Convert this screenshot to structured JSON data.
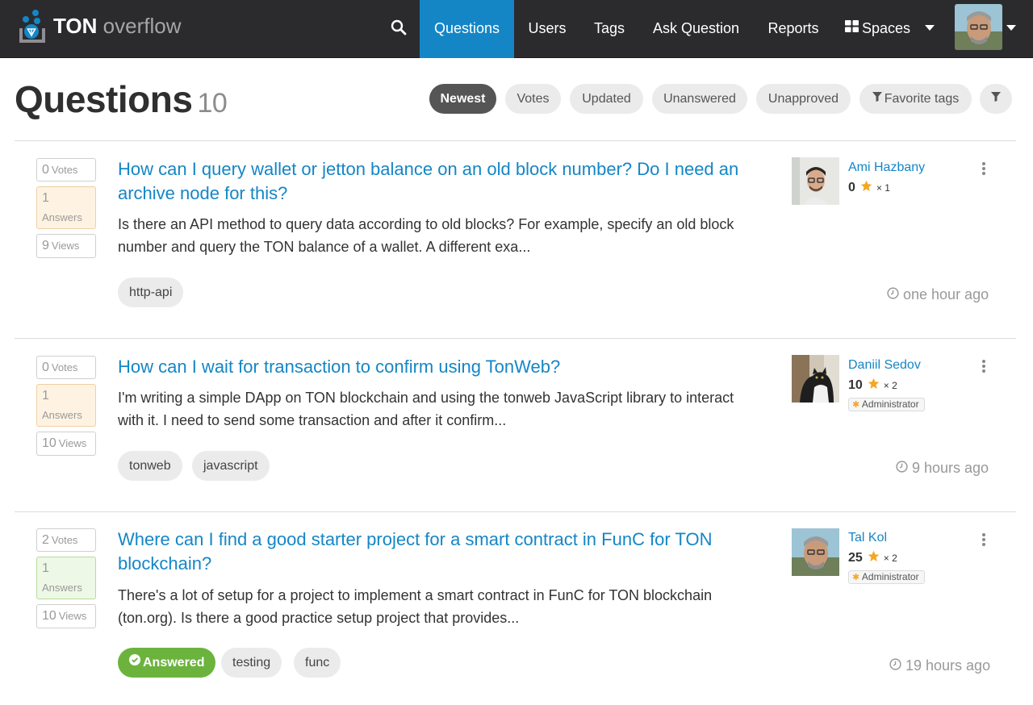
{
  "app": {
    "brand_bold": "TON",
    "brand_light": "overflow"
  },
  "nav": {
    "items": [
      {
        "label": "Questions",
        "active": true
      },
      {
        "label": "Users"
      },
      {
        "label": "Tags"
      },
      {
        "label": "Ask Question"
      },
      {
        "label": "Reports"
      },
      {
        "label": "Spaces"
      }
    ]
  },
  "header": {
    "title": "Questions",
    "count": "10",
    "sort_options": [
      "Newest",
      "Votes",
      "Updated",
      "Unanswered",
      "Unapproved",
      "Favorite tags"
    ],
    "active_sort": "Newest"
  },
  "colors": {
    "navbar": "#2b2b2e",
    "accent": "#1486c6",
    "answered": "#6cb33e",
    "star": "#f5a623"
  },
  "questions": [
    {
      "votes": "0",
      "votes_label": "Votes",
      "answers": "1",
      "answers_label": "Answers",
      "views": "9",
      "views_label": "Views",
      "title": "How can I query wallet or jetton balance on an old block number? Do I need an archive node for this?",
      "excerpt": "Is there an API method to query data according to old blocks? For example, specify an old block number and query the TON balance of a wallet. A different exa...",
      "tags": [
        "http-api"
      ],
      "answered": false,
      "author": {
        "name": "Ami Hazbany",
        "rep": "0",
        "stars": "× 1",
        "badge": ""
      },
      "time": "one hour ago"
    },
    {
      "votes": "0",
      "votes_label": "Votes",
      "answers": "1",
      "answers_label": "Answers",
      "views": "10",
      "views_label": "Views",
      "title": "How can I wait for transaction to confirm using TonWeb?",
      "excerpt": "I'm writing a simple DApp on TON blockchain and using the tonweb JavaScript library to interact with it. I need to send some transaction and after it confirm...",
      "tags": [
        "tonweb",
        "javascript"
      ],
      "answered": false,
      "author": {
        "name": "Daniil Sedov",
        "rep": "10",
        "stars": "× 2",
        "badge": "Administrator"
      },
      "time": "9 hours ago"
    },
    {
      "votes": "2",
      "votes_label": "Votes",
      "answers": "1",
      "answers_label": "Answers",
      "views": "10",
      "views_label": "Views",
      "title": "Where can I find a good starter project for a smart contract in FunC for TON blockchain?",
      "excerpt": "There's a lot of setup for a project to implement a smart contract in FunC for TON blockchain (ton.org). Is there a good practice setup project that provides...",
      "tags": [
        "testing",
        "func"
      ],
      "answered": true,
      "answered_label": "Answered",
      "author": {
        "name": "Tal Kol",
        "rep": "25",
        "stars": "× 2",
        "badge": "Administrator"
      },
      "time": "19 hours ago"
    }
  ]
}
